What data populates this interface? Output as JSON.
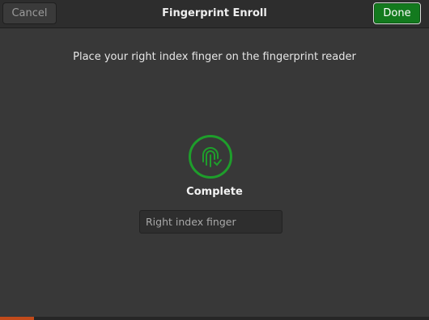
{
  "dialog": {
    "title": "Fingerprint Enroll",
    "cancel_label": "Cancel",
    "done_label": "Done"
  },
  "content": {
    "instruction": "Place your right index finger on the fingerprint reader",
    "status": "Complete",
    "finger_name_value": "Right index finger",
    "status_icon": "fingerprint-icon"
  },
  "colors": {
    "accent_green": "#1e9e2b",
    "done_button": "#137a1e"
  }
}
